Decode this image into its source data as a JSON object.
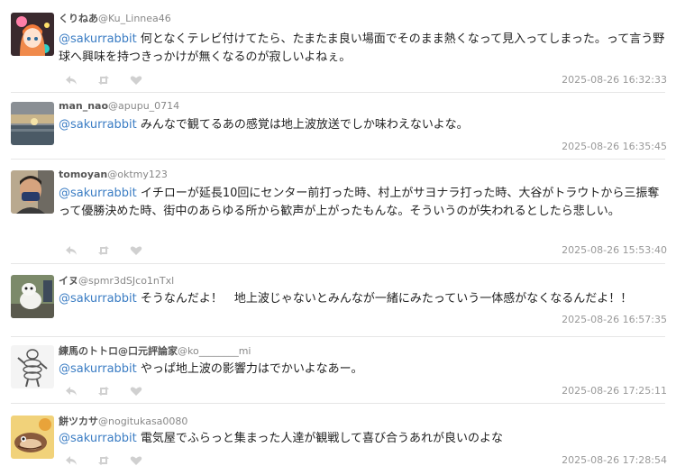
{
  "replies": [
    {
      "name": "くりねあ",
      "handle": "@Ku_Linnea46",
      "mention": "@sakurrabbit",
      "body": " 何となくテレビ付けてたら、たまたま良い場面でそのまま熱くなって見入ってしまった。って言う野球へ興味を持つきっかけが無くなるのが寂しいよねぇ。",
      "time": "2025-08-26 16:32:33",
      "avatar": "anime-girl-avatar"
    },
    {
      "name": "man_nao",
      "handle": "@apupu_0714",
      "mention": "@sakurrabbit",
      "body": " みんなで観てるあの感覚は地上波放送でしか味わえないよな。",
      "time": "2025-08-26 16:35:45",
      "avatar": "sunset-sea-avatar"
    },
    {
      "name": "tomoyan",
      "handle": "@oktmy123",
      "mention": "@sakurrabbit",
      "body": " イチローが延長10回にセンター前打った時、村上がサヨナラ打った時、大谷がトラウトから三振奪って優勝決めた時、街中のあらゆる所から歓声が上がったもんな。そういうのが失われるとしたら悲しい。",
      "time": "2025-08-26 15:53:40",
      "avatar": "person-mask-avatar"
    },
    {
      "name": "イヌ",
      "handle": "@spmr3dSJco1nTxl",
      "mention": "@sakurrabbit",
      "body": " そうなんだよ！　地上波じゃないとみんなが一緒にみたっていう一体感がなくなるんだよ！！",
      "time": "2025-08-26 16:57:35",
      "avatar": "dog-avatar"
    },
    {
      "name": "練馬のトトロ@口元評論家",
      "handle": "@ko________mi",
      "mention": "@sakurrabbit",
      "body": " やっぱ地上波の影響力はでかいよなあー。",
      "time": "2025-08-26 17:25:11",
      "avatar": "michelin-man-avatar"
    },
    {
      "name": "餅ツカサ",
      "handle": "@nogitukasa0080",
      "mention": "@sakurrabbit",
      "body": " 電気屋でふらっと集まった人達が観戦して喜び合うあれが良いのよな",
      "time": "2025-08-26 17:28:54",
      "avatar": "cartoon-fish-avatar"
    }
  ],
  "colors": {
    "mention": "#3b7dc4",
    "divider": "#e6e6e6",
    "timestamp": "#999999",
    "action_icon": "#d0d0d0"
  }
}
